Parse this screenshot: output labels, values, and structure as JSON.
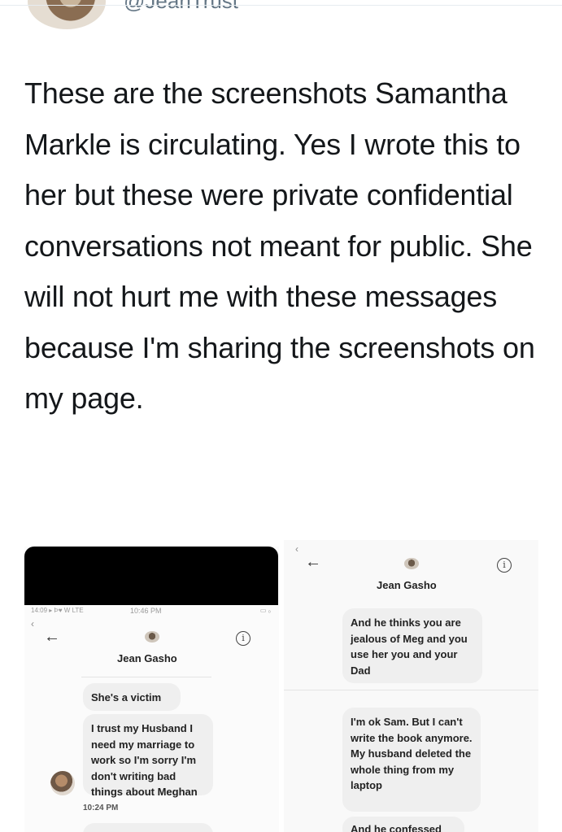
{
  "header": {
    "handle": "@JeanTrust"
  },
  "tweet": {
    "text": "These are the screenshots Samantha Markle is circulating. Yes I wrote this to her but these were private confidential conversations not meant for public. She will not hurt me with these messages because I'm sharing the screenshots on my page."
  },
  "screenshot_left": {
    "status_carrier": "14:09 ▸ Ϸ♥ W LTE",
    "status_time": "10:46 PM",
    "status_battery": "▭ ₀",
    "contact_name": "Jean Gasho",
    "messages": [
      "She's a victim",
      "I trust my Husband I need my marriage to work so I'm sorry I'm don't writing bad things about Meghan"
    ],
    "timestamp": "10:24 PM"
  },
  "screenshot_right": {
    "contact_name": "Jean Gasho",
    "messages": [
      "And he thinks you are jealous of Meg and you use her you and your Dad",
      "I'm ok Sam. But I can't write the book anymore. My husband deleted the whole thing from my laptop",
      "And he confessed"
    ]
  },
  "icons": {
    "back": "arrow-left-icon",
    "info": "info-circle-icon",
    "chevron": "chevron-left-icon"
  }
}
